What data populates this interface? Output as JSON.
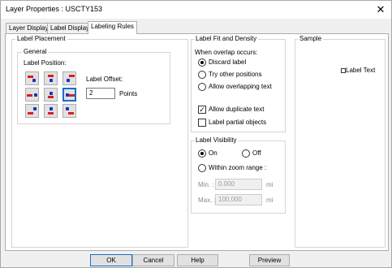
{
  "window": {
    "title": "Layer Properties : USCTY153",
    "close_glyph": "✕"
  },
  "tabs": [
    {
      "label": "Layer Display",
      "active": false
    },
    {
      "label": "Label Display",
      "active": false
    },
    {
      "label": "Labeling Rules",
      "active": true
    }
  ],
  "label_placement": {
    "group_label": "Label Placement",
    "general_label": "General",
    "position_label": "Label Position:",
    "offset_label": "Label Offset:",
    "offset_value": "2",
    "offset_unit": "Points",
    "selected_position": "right"
  },
  "fit_density": {
    "group_label": "Label Fit and Density",
    "overlap_label": "When overlap occurs:",
    "overlap_options": [
      {
        "label": "Discard label",
        "selected": true
      },
      {
        "label": "Try other positions",
        "selected": false
      },
      {
        "label": "Allow overlapping text",
        "selected": false
      }
    ],
    "allow_duplicate": {
      "label": "Allow duplicate text",
      "checked": true
    },
    "label_partial": {
      "label": "Label partial objects",
      "checked": false
    }
  },
  "visibility": {
    "group_label": "Label Visibility",
    "on_label": "On",
    "off_label": "Off",
    "on_selected": true,
    "zoom_label": "Within zoom range :",
    "min_label": "Min. :",
    "min_value": "0.000",
    "max_label": "Max. :",
    "max_value": "100,000",
    "unit": "mi"
  },
  "sample": {
    "group_label": "Sample",
    "text": "Label Text"
  },
  "buttons": {
    "ok": "OK",
    "cancel": "Cancel",
    "help": "Help",
    "preview": "Preview"
  },
  "colors": {
    "selection_border": "#1a6ccf",
    "point_marker": "#1b2fb8",
    "label_marker": "#d62020"
  }
}
